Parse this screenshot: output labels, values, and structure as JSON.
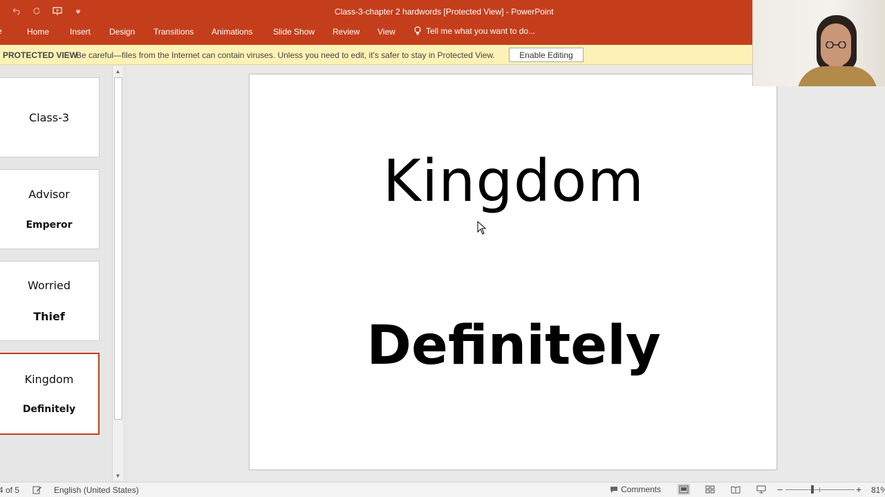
{
  "window": {
    "title": "Class-3-chapter 2 hardwords [Protected View] - PowerPoint"
  },
  "quick_access": [
    {
      "name": "undo-icon",
      "label": "Undo"
    },
    {
      "name": "redo-icon",
      "label": "Redo"
    },
    {
      "name": "start-from-beginning-icon",
      "label": "Start From Beginning"
    },
    {
      "name": "customize-qat-icon",
      "label": "Customize Quick Access Toolbar"
    }
  ],
  "ribbon": {
    "file_stub": "e",
    "tabs": [
      "Home",
      "Insert",
      "Design",
      "Transitions",
      "Animations",
      "Slide Show",
      "Review",
      "View"
    ],
    "tell_me": "Tell me what you want to do..."
  },
  "protected_view": {
    "title": "PROTECTED VIEW",
    "message": "Be careful—files from the Internet can contain viruses. Unless you need to edit, it's safer to stay in Protected View.",
    "button": "Enable Editing"
  },
  "thumbnails": [
    {
      "title": "Class-3",
      "body": ""
    },
    {
      "title": "Advisor",
      "body": "Emperor"
    },
    {
      "title": "Worried",
      "body": "Thief"
    },
    {
      "title": "Kingdom",
      "body": "Definitely",
      "selected": true
    }
  ],
  "slide": {
    "title": "Kingdom",
    "body": "Definitely"
  },
  "status": {
    "slide_indicator": "4 of 5",
    "language": "English (United States)",
    "comments": "Comments",
    "zoom": "81%"
  },
  "colors": {
    "accent": "#c43e1c",
    "protected_bar": "#fdf2b5"
  }
}
